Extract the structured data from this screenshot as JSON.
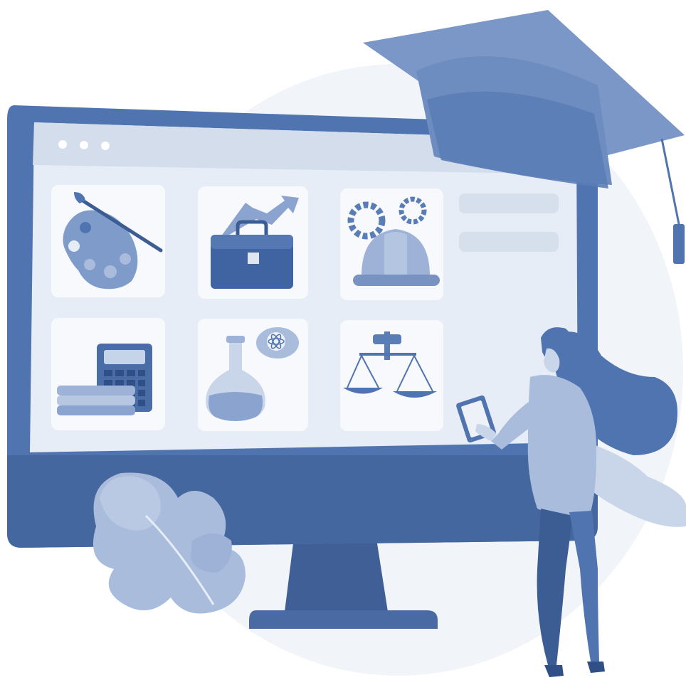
{
  "colors": {
    "primary": "#4d72ad",
    "primary_dark": "#3b5d94",
    "primary_mid": "#7c98c6",
    "primary_light": "#a9bcdb",
    "pale": "#dfe6f1",
    "paler": "#eef2f8",
    "card": "#f7f9fc",
    "screen": "#e6ecf5"
  },
  "browser": {
    "dots": 3
  },
  "catalog": {
    "cards": [
      {
        "icon": "art-palette-icon"
      },
      {
        "icon": "business-briefcase-icon"
      },
      {
        "icon": "engineering-helmet-gears-icon"
      },
      {
        "icon": "accounting-calculator-books-icon"
      },
      {
        "icon": "science-flask-atom-icon"
      },
      {
        "icon": "law-scales-icon"
      }
    ],
    "side_placeholders": 2
  }
}
